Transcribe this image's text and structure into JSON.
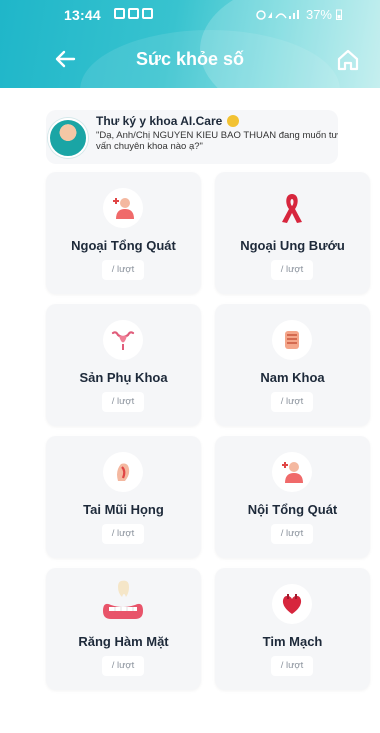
{
  "status_bar": {
    "time": "13:44",
    "battery": "37%"
  },
  "header": {
    "title": "Sức khỏe số"
  },
  "assistant": {
    "name": "Thư ký y khoa AI.Care",
    "message": "\"Dạ, Anh/Chị NGUYEN KIEU BAO THUAN đang muốn tư vấn chuyên khoa nào ạ?\""
  },
  "specialties": [
    {
      "name": "Ngoại Tổng Quát",
      "unit": "/ lượt",
      "icon": "surgeon-icon"
    },
    {
      "name": "Ngoại Ung Bướu",
      "unit": "/ lượt",
      "icon": "ribbon-icon"
    },
    {
      "name": "Sản Phụ Khoa",
      "unit": "/ lượt",
      "icon": "uterus-icon"
    },
    {
      "name": "Nam Khoa",
      "unit": "/ lượt",
      "icon": "male-organ-icon"
    },
    {
      "name": "Tai Mũi Họng",
      "unit": "/ lượt",
      "icon": "ent-icon"
    },
    {
      "name": "Nội Tổng Quát",
      "unit": "/ lượt",
      "icon": "internal-medicine-icon"
    },
    {
      "name": "Răng Hàm Mặt",
      "unit": "/ lượt",
      "icon": "tooth-icon"
    },
    {
      "name": "Tim Mạch",
      "unit": "/ lượt",
      "icon": "heart-icon"
    }
  ],
  "colors": {
    "header_accent": "#1fb6c9",
    "card_bg": "#f5f6f8",
    "ribbon": "#d7263d"
  }
}
